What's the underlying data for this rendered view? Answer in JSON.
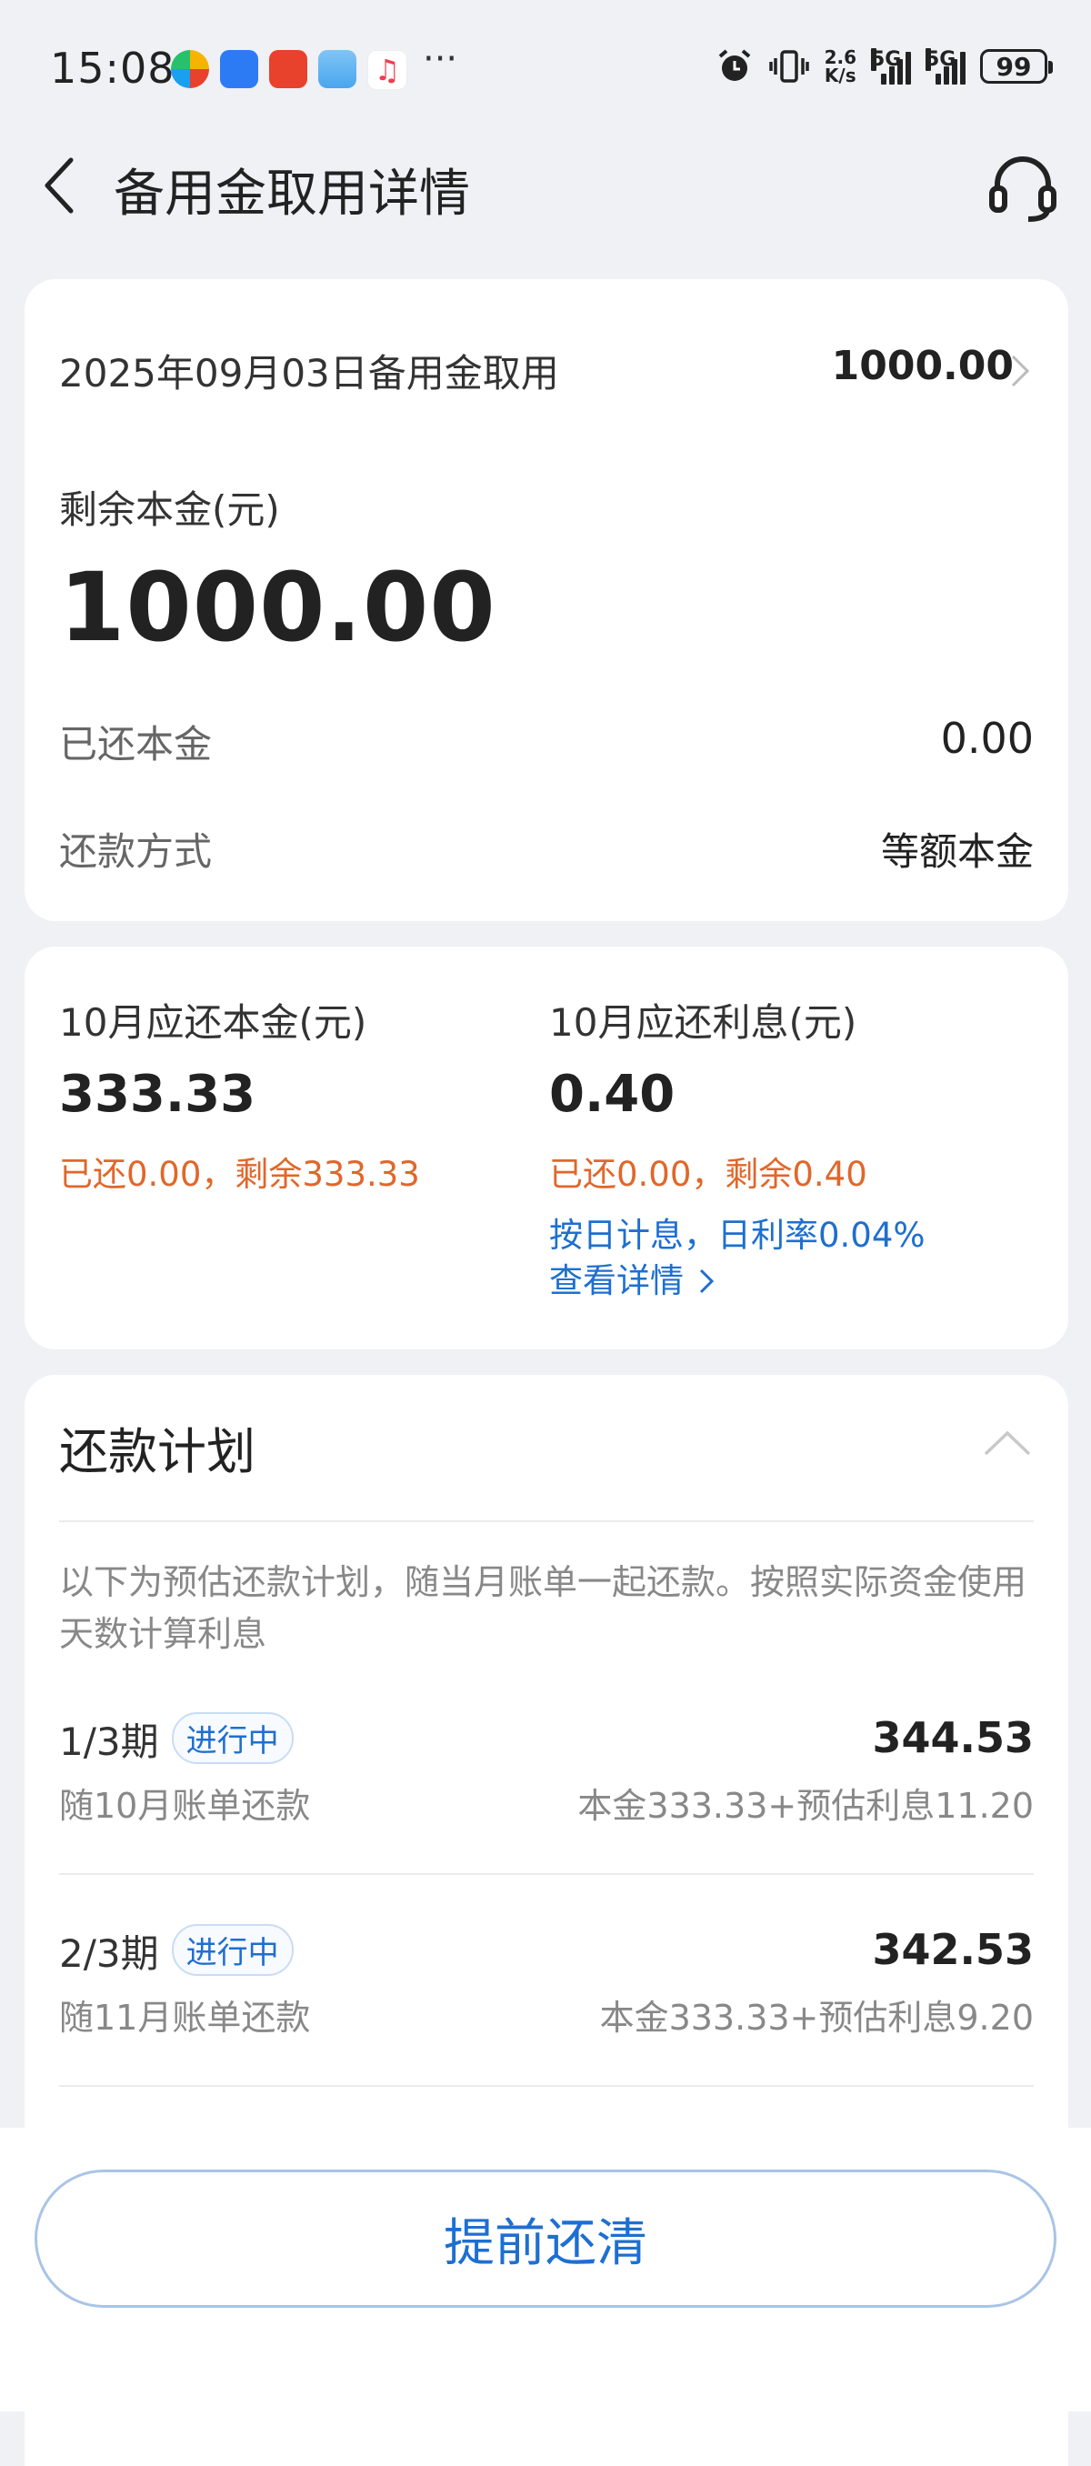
{
  "status_bar": {
    "time": "15:08",
    "dots": "···",
    "net_speed": "2.6",
    "net_unit": "K/s",
    "signal1": "5G",
    "signal2": "5G",
    "battery": "99"
  },
  "header": {
    "title": "备用金取用详情"
  },
  "summary": {
    "record_title": "2025年09月03日备用金取用",
    "record_amount": "1000.00",
    "remaining_label": "剩余本金(元)",
    "remaining_value": "1000.00",
    "repaid_label": "已还本金",
    "repaid_value": "0.00",
    "method_label": "还款方式",
    "method_value": "等额本金"
  },
  "monthly": {
    "principal_label": "10月应还本金(元)",
    "principal_value": "333.33",
    "principal_status": "已还0.00，剩余333.33",
    "interest_label": "10月应还利息(元)",
    "interest_value": "0.40",
    "interest_status": "已还0.00，剩余0.40",
    "rate_note": "按日计息，日利率0.04%",
    "detail_link": "查看详情"
  },
  "plan": {
    "title": "还款计划",
    "note": "以下为预估还款计划，随当月账单一起还款。按照实际资金使用天数计算利息",
    "items": [
      {
        "period": "1/3期",
        "badge": "进行中",
        "desc": "随10月账单还款",
        "amount": "344.53",
        "breakdown": "本金333.33+预估利息11.20"
      },
      {
        "period": "2/3期",
        "badge": "进行中",
        "desc": "随11月账单还款",
        "amount": "342.53",
        "breakdown": "本金333.33+预估利息9.20"
      }
    ]
  },
  "actions": {
    "payoff": "提前还清"
  },
  "colors": {
    "accent_blue": "#1e6fd0",
    "warning_orange": "#e0672a",
    "background": "#eff1f5"
  }
}
